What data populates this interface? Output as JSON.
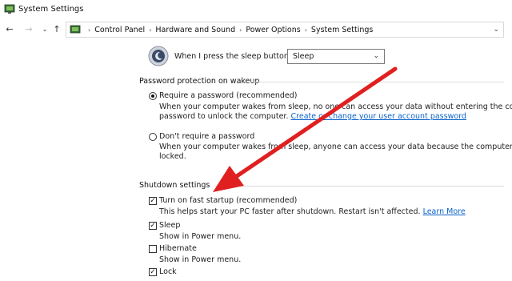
{
  "window": {
    "title": "System Settings",
    "accent_color": "#e02020"
  },
  "nav": {
    "back_icon": "back-arrow-icon",
    "forward_icon": "forward-arrow-icon",
    "recent_icon": "chevron-down-icon",
    "up_icon": "up-arrow-icon",
    "breadcrumbs": [
      "Control Panel",
      "Hardware and Sound",
      "Power Options",
      "System Settings"
    ],
    "dropdown_icon": "chevron-down-icon"
  },
  "sleep_button": {
    "label": "When I press the sleep button:",
    "value": "Sleep"
  },
  "password_section": {
    "title": "Password protection on wakeup",
    "require": {
      "label": "Require a password (recommended)",
      "checked": true,
      "desc_line1": "When your computer wakes from sleep, no one can access your data without entering the correct",
      "desc_line2_text": "password to unlock the computer.",
      "link": "Create or change your user account password"
    },
    "dont_require": {
      "label": "Don't require a password",
      "checked": false,
      "desc_line1": "When your computer wakes from sleep, anyone can access your data because the computer isn't",
      "desc_line2": "locked."
    }
  },
  "shutdown_section": {
    "title": "Shutdown settings",
    "fast_startup": {
      "label": "Turn on fast startup (recommended)",
      "checked": true,
      "desc": "This helps start your PC faster after shutdown. Restart isn't affected.",
      "link": "Learn More"
    },
    "sleep": {
      "label": "Sleep",
      "checked": true,
      "desc": "Show in Power menu."
    },
    "hibernate": {
      "label": "Hibernate",
      "checked": false,
      "desc": "Show in Power menu."
    },
    "lock": {
      "label": "Lock",
      "checked": true
    }
  }
}
